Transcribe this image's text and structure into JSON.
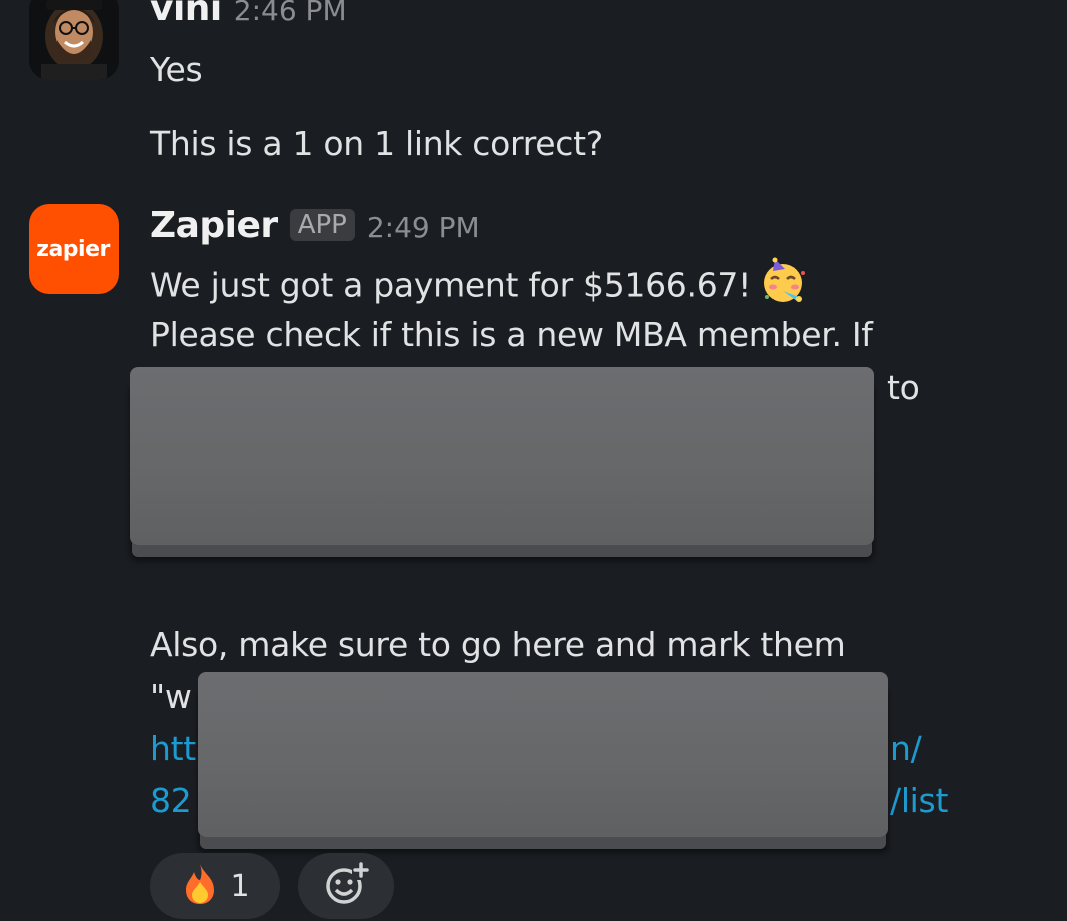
{
  "messages": [
    {
      "sender": "vini",
      "time": "2:46 PM",
      "lines": [
        "Yes",
        "This is a 1 on 1 link correct?"
      ]
    },
    {
      "sender": "Zapier",
      "badge": "APP",
      "time": "2:49 PM",
      "logo_text": "zapier",
      "lines": [
        "We just got a payment for $5166.67!",
        "Please check if this is a new MBA member. If",
        "to",
        "Also, make sure to go here and mark them",
        "\"w",
        "htt",
        "n/",
        "82",
        "/list"
      ]
    }
  ],
  "reactions": [
    {
      "emoji": "fire-emoji",
      "count": "1"
    }
  ],
  "icons": {
    "party_emoji": "partying-face-emoji",
    "add_reaction": "add-reaction-icon"
  },
  "colors": {
    "background": "#1a1d21",
    "link": "#1d9bd1",
    "zapier_brand": "#ff4f00"
  }
}
